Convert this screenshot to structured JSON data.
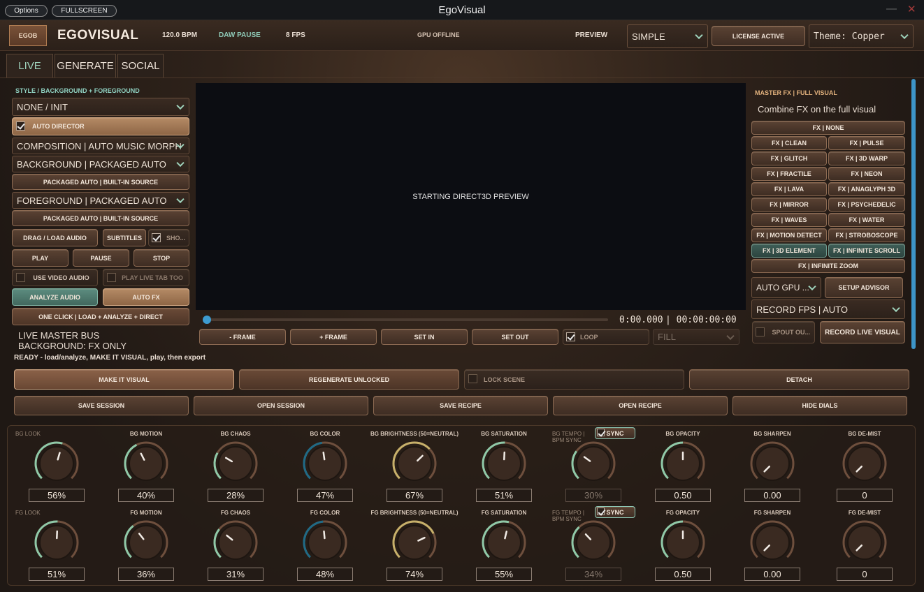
{
  "titlebar": {
    "options": "Options",
    "fullscreen": "FULLSCREEN",
    "title": "EgoVisual",
    "minimize": "—",
    "close": "✕"
  },
  "header": {
    "logo_badge": "EGOB",
    "app_name": "EGOVISUAL",
    "bpm": "120.0 BPM",
    "daw": "DAW PAUSE",
    "fps": "8 FPS",
    "gpu": "GPU OFFLINE",
    "preview_label": "PREVIEW",
    "preview_mode": "SIMPLE",
    "license": "LICENSE ACTIVE",
    "theme": "Theme: Copper"
  },
  "tabs": [
    "LIVE",
    "GENERATE",
    "SOCIAL"
  ],
  "left": {
    "section_title": "STYLE / BACKGROUND + FOREGROUND",
    "style_select": "NONE / INIT",
    "auto_director": "AUTO DIRECTOR",
    "composition": "COMPOSITION | AUTO MUSIC MORPH",
    "background": "BACKGROUND | PACKAGED AUTO",
    "bg_source": "PACKAGED AUTO | BUILT-IN SOURCE",
    "foreground": "FOREGROUND | PACKAGED AUTO",
    "fg_source": "PACKAGED AUTO | BUILT-IN SOURCE",
    "drag_load": "DRAG / LOAD AUDIO",
    "subtitles": "SUBTITLES",
    "show": "SHO...",
    "play": "PLAY",
    "pause": "PAUSE",
    "stop": "STOP",
    "use_video_audio": "USE VIDEO AUDIO",
    "play_live_tab": "PLAY LIVE TAB TOO",
    "analyze": "ANALYZE AUDIO",
    "auto_fx": "AUTO FX",
    "one_click": "ONE CLICK | LOAD + ANALYZE + DIRECT",
    "master_bus": "LIVE MASTER BUS",
    "bg_mode": "BACKGROUND: FX ONLY"
  },
  "preview": {
    "status": "STARTING DIRECT3D PREVIEW",
    "time": "0:00.000",
    "duration": "| 00:00:00:00",
    "minus_frame": "- FRAME",
    "plus_frame": "+ FRAME",
    "set_in": "SET IN",
    "set_out": "SET OUT",
    "loop": "LOOP",
    "fill": "FILL",
    "progress": 0
  },
  "right": {
    "section_title": "MASTER FX | FULL VISUAL",
    "subtitle": "Combine FX on the full visual",
    "fx_none": "FX | NONE",
    "fx_pairs": [
      [
        "FX | CLEAN",
        "FX | PULSE"
      ],
      [
        "FX | GLITCH",
        "FX | 3D WARP"
      ],
      [
        "FX | FRACTILE",
        "FX | NEON"
      ],
      [
        "FX | LAVA",
        "FX | ANAGLYPH 3D"
      ],
      [
        "FX | MIRROR",
        "FX | PSYCHEDELIC"
      ],
      [
        "FX | WAVES",
        "FX | WATER"
      ],
      [
        "FX | MOTION DETECT",
        "FX | STROBOSCOPE"
      ],
      [
        "FX | 3D ELEMENT",
        "FX | INFINITE SCROLL"
      ]
    ],
    "fx_zoom": "FX | INFINITE ZOOM",
    "auto_gpu": "AUTO GPU ...",
    "setup_advisor": "SETUP ADVISOR",
    "record_fps": "RECORD FPS | AUTO",
    "spout": "SPOUT OU...",
    "record_live": "RECORD LIVE VISUAL"
  },
  "status_line": "READY - load/analyze, MAKE IT VISUAL, play, then export",
  "actions": {
    "make_visual": "MAKE IT VISUAL",
    "regenerate": "REGENERATE UNLOCKED",
    "lock_scene": "LOCK SCENE",
    "detach": "DETACH",
    "save_session": "SAVE SESSION",
    "open_session": "OPEN SESSION",
    "save_recipe": "SAVE RECIPE",
    "open_recipe": "OPEN RECIPE",
    "hide_dials": "HIDE DIALS"
  },
  "dials": {
    "sync": "SYNC",
    "bg": [
      {
        "label": "BG LOOK",
        "value": "56%",
        "level": 0.56
      },
      {
        "label": "BG MOTION",
        "value": "40%",
        "level": 0.4
      },
      {
        "label": "BG CHAOS",
        "value": "28%",
        "level": 0.28
      },
      {
        "label": "BG COLOR",
        "value": "47%",
        "level": 0.47
      },
      {
        "label": "BG BRIGHTNESS (50=NEUTRAL)",
        "value": "67%",
        "level": 0.67
      },
      {
        "label": "BG SATURATION",
        "value": "51%",
        "level": 0.51
      },
      {
        "label": "BG TEMPO | BPM SYNC",
        "value": "30%",
        "level": 0.3
      },
      {
        "label": "BG OPACITY",
        "value": "0.50",
        "level": 0.5
      },
      {
        "label": "BG SHARPEN",
        "value": "0.00",
        "level": 0.0
      },
      {
        "label": "BG DE-MIST",
        "value": "0",
        "level": 0.0
      }
    ],
    "fg": [
      {
        "label": "FG LOOK",
        "value": "51%",
        "level": 0.51
      },
      {
        "label": "FG MOTION",
        "value": "36%",
        "level": 0.36
      },
      {
        "label": "FG CHAOS",
        "value": "31%",
        "level": 0.31
      },
      {
        "label": "FG COLOR",
        "value": "48%",
        "level": 0.48
      },
      {
        "label": "FG BRIGHTNESS (50=NEUTRAL)",
        "value": "74%",
        "level": 0.74
      },
      {
        "label": "FG SATURATION",
        "value": "55%",
        "level": 0.55
      },
      {
        "label": "FG TEMPO | BPM SYNC",
        "value": "34%",
        "level": 0.34
      },
      {
        "label": "FG OPACITY",
        "value": "0.50",
        "level": 0.5
      },
      {
        "label": "FG SHARPEN",
        "value": "0.00",
        "level": 0.0
      },
      {
        "label": "FG DE-MIST",
        "value": "0",
        "level": 0.0
      }
    ]
  },
  "colors": {
    "accent_teal": "#9fd3bc",
    "accent_copper": "#e0b07c",
    "label_teal": "#8fd0c0"
  }
}
